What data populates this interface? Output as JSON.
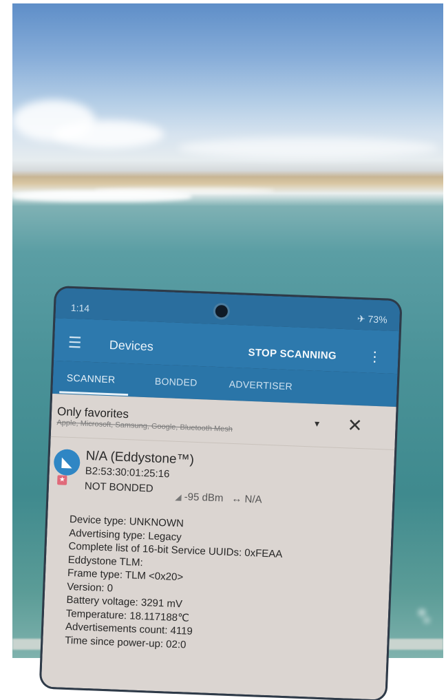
{
  "status_bar": {
    "time": "1:14",
    "right": "✈ 73%"
  },
  "app_bar": {
    "title": "Devices",
    "action": "STOP SCANNING"
  },
  "tabs": [
    "SCANNER",
    "BONDED",
    "ADVERTISER"
  ],
  "filter": {
    "title": "Only favorites",
    "subtitle": "Apple, Microsoft, Samsung, Google, Bluetooth Mesh"
  },
  "device": {
    "name": "N/A  (Eddystone™)",
    "mac": "B2:53:30:01:25:16",
    "bond_state": "NOT BONDED",
    "rssi": "-95 dBm",
    "interval": "↔ N/A",
    "details": [
      "Device type: UNKNOWN",
      "Advertising type: Legacy",
      "Complete list of 16-bit Service UUIDs: 0xFEAA",
      "Eddystone TLM:",
      "Frame type: TLM <0x20>",
      "Version: 0",
      "Battery voltage: 3291 mV",
      "Temperature: 18.117188℃",
      "Advertisements count: 4119",
      "Time since power-up: 02:0"
    ]
  },
  "icons": {
    "menu": "menu-icon",
    "overflow": "more-vert-icon",
    "dropdown": "dropdown-arrow-icon",
    "clear": "close-icon",
    "device": "eddystone-beacon-icon",
    "favorite": "star-icon",
    "signal": "signal-strength-icon"
  },
  "colors": {
    "app_bar": "#2d79ad",
    "status_bar": "#2a6e9e",
    "list_bg": "#eae2dd"
  }
}
